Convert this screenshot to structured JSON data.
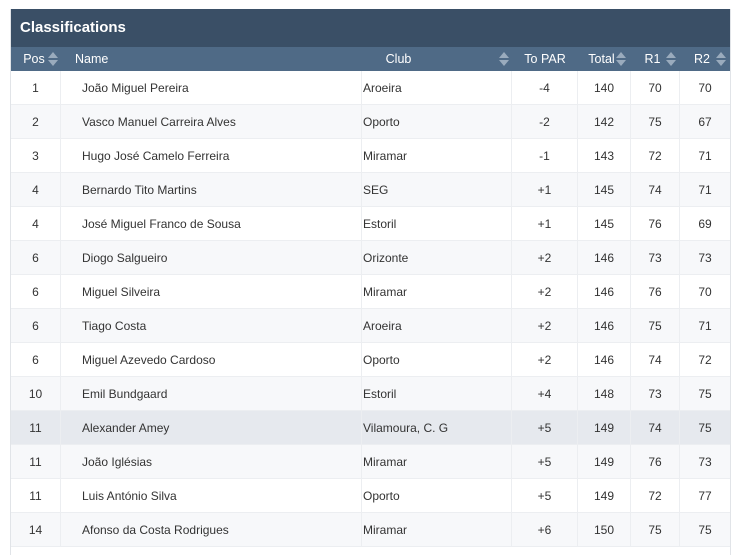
{
  "panel": {
    "title": "Classifications"
  },
  "columns": {
    "pos": "Pos",
    "name": "Name",
    "club": "Club",
    "to_par": "To PAR",
    "total": "Total",
    "r1": "R1",
    "r2": "R2"
  },
  "rows": [
    {
      "pos": "1",
      "name": "João Miguel Pereira",
      "club": "Aroeira",
      "to_par": "-4",
      "total": "140",
      "r1": "70",
      "r2": "70"
    },
    {
      "pos": "2",
      "name": "Vasco Manuel Carreira Alves",
      "club": "Oporto",
      "to_par": "-2",
      "total": "142",
      "r1": "75",
      "r2": "67"
    },
    {
      "pos": "3",
      "name": "Hugo José Camelo Ferreira",
      "club": "Miramar",
      "to_par": "-1",
      "total": "143",
      "r1": "72",
      "r2": "71"
    },
    {
      "pos": "4",
      "name": "Bernardo Tito Martins",
      "club": "SEG",
      "to_par": "+1",
      "total": "145",
      "r1": "74",
      "r2": "71"
    },
    {
      "pos": "4",
      "name": "José Miguel Franco de Sousa",
      "club": "Estoril",
      "to_par": "+1",
      "total": "145",
      "r1": "76",
      "r2": "69"
    },
    {
      "pos": "6",
      "name": "Diogo Salgueiro",
      "club": "Orizonte",
      "to_par": "+2",
      "total": "146",
      "r1": "73",
      "r2": "73"
    },
    {
      "pos": "6",
      "name": "Miguel Silveira",
      "club": "Miramar",
      "to_par": "+2",
      "total": "146",
      "r1": "76",
      "r2": "70"
    },
    {
      "pos": "6",
      "name": "Tiago Costa",
      "club": "Aroeira",
      "to_par": "+2",
      "total": "146",
      "r1": "75",
      "r2": "71"
    },
    {
      "pos": "6",
      "name": "Miguel Azevedo Cardoso",
      "club": "Oporto",
      "to_par": "+2",
      "total": "146",
      "r1": "74",
      "r2": "72"
    },
    {
      "pos": "10",
      "name": "Emil Bundgaard",
      "club": "Estoril",
      "to_par": "+4",
      "total": "148",
      "r1": "73",
      "r2": "75"
    },
    {
      "pos": "11",
      "name": "Alexander Amey",
      "club": "Vilamoura, C. G",
      "to_par": "+5",
      "total": "149",
      "r1": "74",
      "r2": "75"
    },
    {
      "pos": "11",
      "name": "João Iglésias",
      "club": "Miramar",
      "to_par": "+5",
      "total": "149",
      "r1": "76",
      "r2": "73"
    },
    {
      "pos": "11",
      "name": "Luis António Silva",
      "club": "Oporto",
      "to_par": "+5",
      "total": "149",
      "r1": "72",
      "r2": "77"
    },
    {
      "pos": "14",
      "name": "Afonso da Costa Rodrigues",
      "club": "Miramar",
      "to_par": "+6",
      "total": "150",
      "r1": "75",
      "r2": "75"
    }
  ],
  "highlighted_row": 10,
  "colors": {
    "title_bg": "#3a4f66",
    "header_bg": "#4f6a86",
    "highlight_bg": "#e6e9ee"
  }
}
